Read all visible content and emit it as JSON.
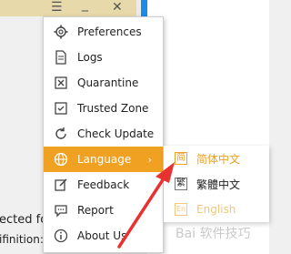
{
  "window": {
    "controls": {
      "menu_icon": "hamburger-icon",
      "minimize_icon": "minimize-icon",
      "close_icon": "close-icon"
    },
    "background_text": {
      "line1": "ected fo",
      "line2": "ifinition: 2"
    }
  },
  "menu": {
    "items": [
      {
        "label": "Preferences",
        "icon": "gear-icon"
      },
      {
        "label": "Logs",
        "icon": "document-icon"
      },
      {
        "label": "Quarantine",
        "icon": "quarantine-box-icon"
      },
      {
        "label": "Trusted Zone",
        "icon": "shield-icon"
      },
      {
        "label": "Check Update",
        "icon": "refresh-icon"
      },
      {
        "label": "Language",
        "icon": "globe-icon",
        "submenu_arrow": "›",
        "active": true
      },
      {
        "label": "Feedback",
        "icon": "edit-icon"
      },
      {
        "label": "Report",
        "icon": "chat-bubble-icon"
      },
      {
        "label": "About Us",
        "icon": "info-icon"
      }
    ]
  },
  "language_submenu": {
    "items": [
      {
        "badge": "简",
        "label": "简体中文",
        "selected": true
      },
      {
        "badge": "繁",
        "label": "繁體中文"
      },
      {
        "badge": "En",
        "label": "English"
      }
    ]
  },
  "watermark": {
    "text": "Bai 软件技巧"
  },
  "colors": {
    "accent": "#f0a122",
    "annotation_arrow": "#e8322f",
    "window_blue": "#1a8ce8"
  }
}
